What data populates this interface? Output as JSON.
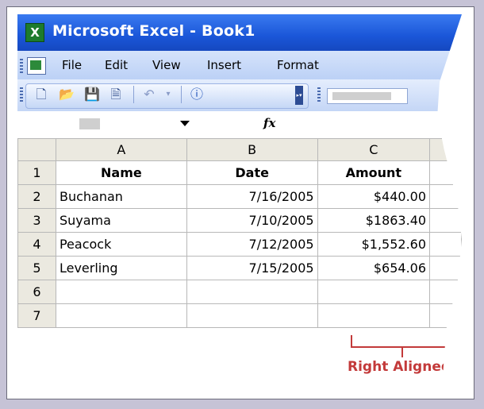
{
  "window": {
    "title": "Microsoft Excel - Book1",
    "app_icon": "excel-icon"
  },
  "menu": {
    "items": [
      "File",
      "Edit",
      "View",
      "Insert",
      "Format"
    ]
  },
  "toolbar": {
    "buttons": [
      "new-icon",
      "open-icon",
      "save-icon",
      "print-preview-icon",
      "undo-icon",
      "undo-dropdown-icon",
      "help-icon"
    ]
  },
  "formula_bar": {
    "fx_label": "fx"
  },
  "sheet": {
    "columns": [
      "A",
      "B",
      "C"
    ],
    "rows": [
      {
        "num": "1",
        "a": "Name",
        "b": "Date",
        "c": "Amount"
      },
      {
        "num": "2",
        "a": "Buchanan",
        "b": "7/16/2005",
        "c": "$440.00"
      },
      {
        "num": "3",
        "a": "Suyama",
        "b": "7/10/2005",
        "c": "$1863.40"
      },
      {
        "num": "4",
        "a": "Peacock",
        "b": "7/12/2005",
        "c": "$1,552.60"
      },
      {
        "num": "5",
        "a": "Leverling",
        "b": "7/15/2005",
        "c": "$654.06"
      },
      {
        "num": "6",
        "a": "",
        "b": "",
        "c": ""
      },
      {
        "num": "7",
        "a": "",
        "b": "",
        "c": ""
      }
    ]
  },
  "annotation": {
    "label": "Right Aligned",
    "color": "#c33a3a"
  },
  "colors": {
    "titlebar": "#1a56d8",
    "header": "#ebe9e0"
  }
}
